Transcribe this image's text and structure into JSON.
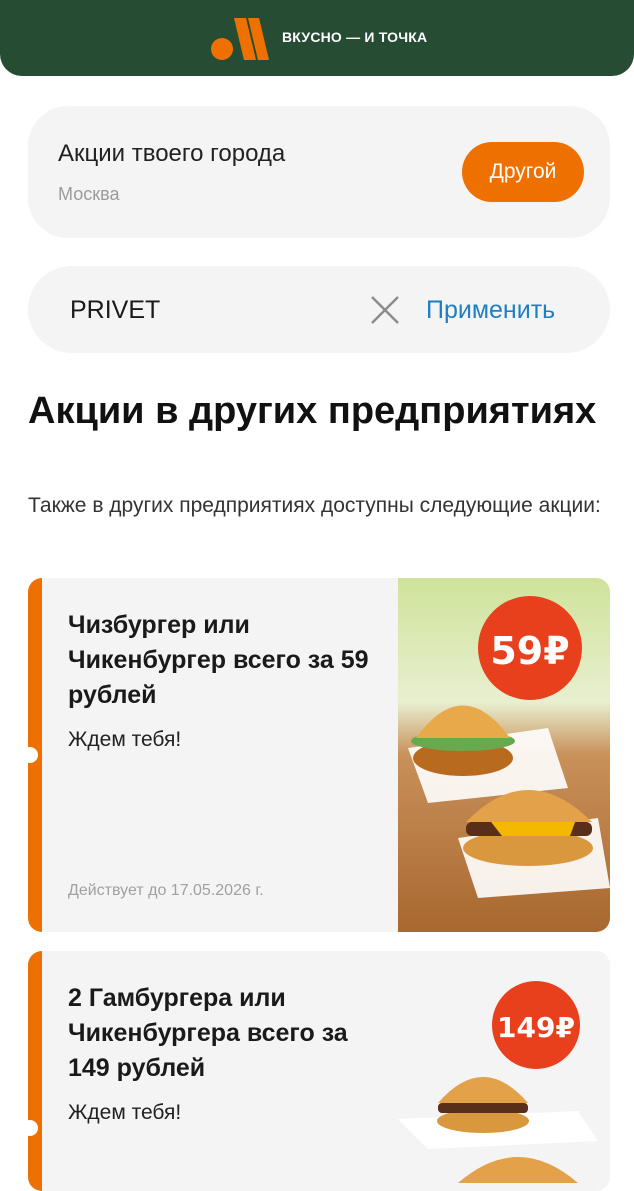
{
  "header": {
    "logo_text": "ВКУСНО — И ТОЧКА",
    "colors": {
      "bg": "#264d33",
      "accent": "#ee7100"
    }
  },
  "city": {
    "title": "Акции твоего города",
    "name": "Москва",
    "button_label": "Другой"
  },
  "promo": {
    "value": "PRIVET",
    "clear_icon": "close-icon",
    "apply_label": "Применить"
  },
  "section": {
    "title": "Акции в других предприятиях",
    "subtitle": "Также в других предприятиях доступны следующие акции:"
  },
  "offers": [
    {
      "title": "Чизбургер или Чикенбургер всего за 59 рублей",
      "subtitle": "Ждем тебя!",
      "valid": "Действует до 17.05.2026 г.",
      "price_badge": "59₽"
    },
    {
      "title": "2 Гамбургера или Чикенбургера всего за 149 рублей",
      "subtitle": "Ждем тебя!",
      "price_badge": "149₽"
    }
  ]
}
